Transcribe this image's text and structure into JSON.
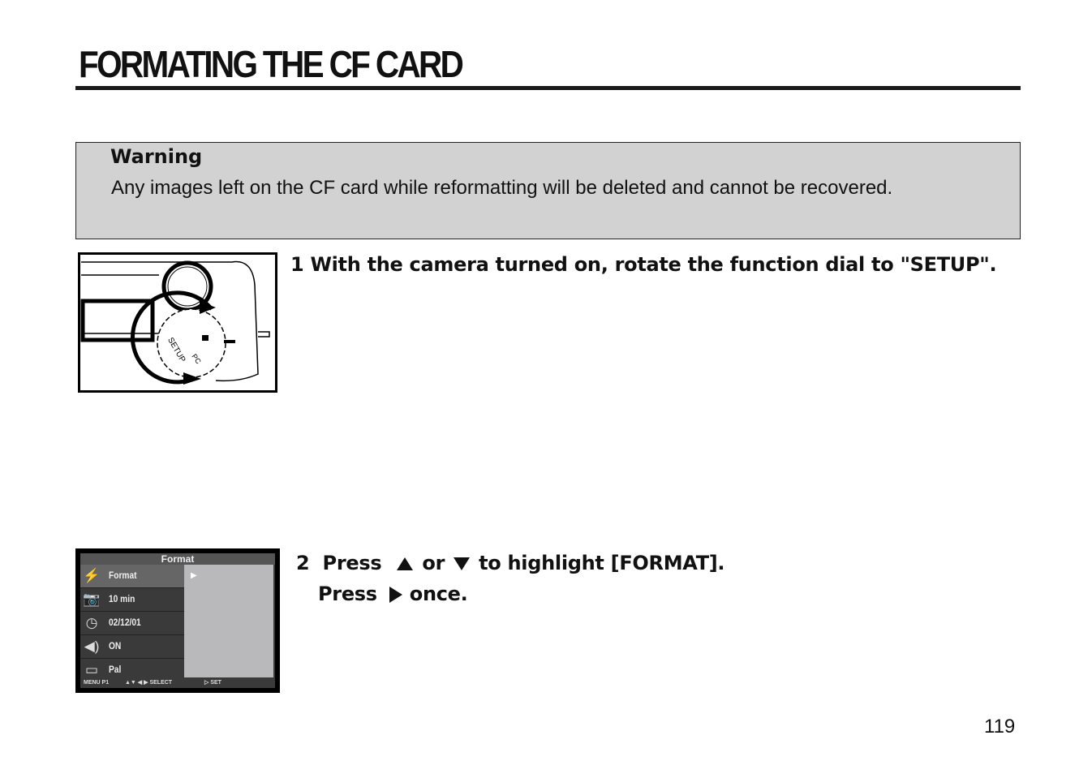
{
  "title": "FORMATING THE CF CARD",
  "warning": {
    "heading": "Warning",
    "text": "Any images left on the CF card while reformatting will be deleted and cannot be recovered."
  },
  "step1": {
    "text": "1 With the camera turned on, rotate the function dial to \"SETUP\"."
  },
  "camera_dial": {
    "labels": [
      "SETUP",
      "PC",
      "▶",
      "camera-icon"
    ]
  },
  "step2": {
    "number": "2",
    "press": "Press",
    "or": "or",
    "highlight": "to highlight [FORMAT].",
    "press2": "Press",
    "once": "once."
  },
  "lcd": {
    "header": "Format",
    "rows": [
      {
        "icon": "format-icon",
        "label": "Format"
      },
      {
        "icon": "sleep-camera-icon",
        "label": "10 min"
      },
      {
        "icon": "clock-icon",
        "label": "02/12/01"
      },
      {
        "icon": "speaker-icon",
        "label": "ON"
      },
      {
        "icon": "tv-icon",
        "label": "Pal"
      }
    ],
    "footer": {
      "menu": "MENU P1",
      "nav": "▲▼  ◀ ▶ SELECT",
      "set": "▷  SET"
    }
  },
  "page_number": "119"
}
